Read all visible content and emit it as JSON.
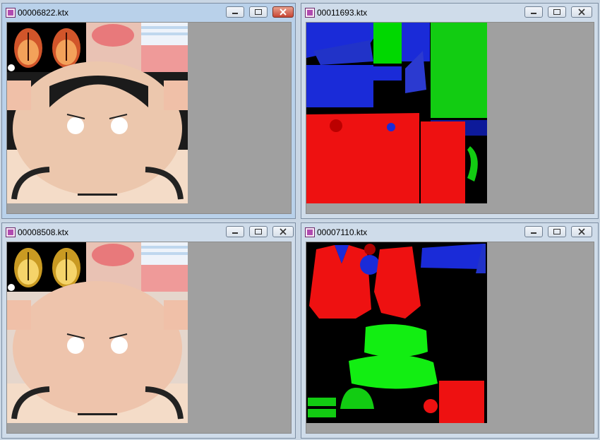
{
  "windows": [
    {
      "title": "00006822.ktx",
      "active": true
    },
    {
      "title": "00011693.ktx",
      "active": false
    },
    {
      "title": "00008508.ktx",
      "active": false
    },
    {
      "title": "00007110.ktx",
      "active": false
    }
  ],
  "colors": {
    "workspace": "#a0a0a0",
    "active_title": "#b9d1ea",
    "inactive_title": "#cfdcea",
    "close_hot": "#c74634"
  },
  "icons": {
    "app": "image-file-icon",
    "minimize": "minimize-icon",
    "maximize": "maximize-icon",
    "close": "close-icon"
  }
}
